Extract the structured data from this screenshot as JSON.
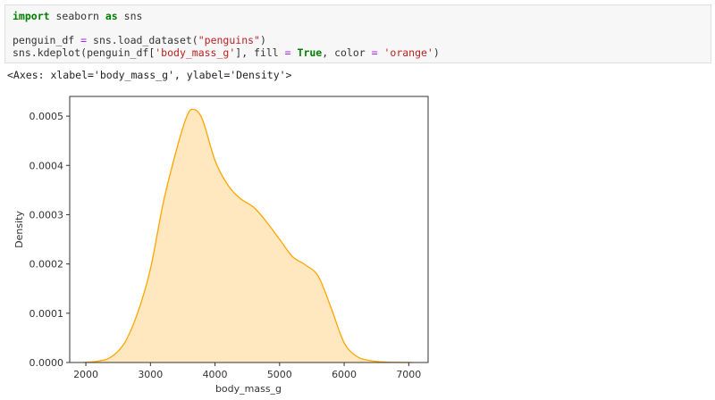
{
  "code": {
    "line1": {
      "kw1": "import",
      "mid": " seaborn ",
      "kw2": "as",
      "end": " sns"
    },
    "line3": {
      "a": "penguin_df ",
      "op": "=",
      "b": " sns.load_dataset(",
      "s": "\"penguins\"",
      "c": ")"
    },
    "line4": {
      "a": "sns.kdeplot(penguin_df[",
      "s1": "'body_mass_g'",
      "b": "], fill ",
      "op1": "=",
      "kw": " True",
      "c": ", color ",
      "op2": "=",
      "s2": " 'orange'",
      "d": ")"
    }
  },
  "output_text": "<Axes: xlabel='body_mass_g', ylabel='Density'>",
  "chart_data": {
    "type": "area",
    "title": "",
    "xlabel": "body_mass_g",
    "ylabel": "Density",
    "xlim": [
      1750,
      7300
    ],
    "ylim": [
      0,
      0.00054
    ],
    "xticks": [
      "2000",
      "3000",
      "4000",
      "5000",
      "6000",
      "7000"
    ],
    "yticks": [
      "0.0000",
      "0.0001",
      "0.0002",
      "0.0003",
      "0.0004",
      "0.0005"
    ],
    "grid": false,
    "color": "#ffa500",
    "fill_opacity": 0.25,
    "x": [
      1950,
      2200,
      2400,
      2600,
      2800,
      3000,
      3200,
      3400,
      3550,
      3650,
      3800,
      4000,
      4200,
      4400,
      4600,
      4800,
      5000,
      5200,
      5400,
      5600,
      5800,
      6000,
      6200,
      6400,
      6600,
      6800,
      7050
    ],
    "y": [
      0,
      3e-06,
      1.2e-05,
      4e-05,
      0.0001,
      0.00019,
      0.000325,
      0.00043,
      0.000495,
      0.000514,
      0.000495,
      0.00041,
      0.00036,
      0.000332,
      0.000315,
      0.000285,
      0.00025,
      0.000215,
      0.000198,
      0.000175,
      0.00011,
      4e-05,
      1.2e-05,
      4e-06,
      1e-06,
      3e-07,
      0
    ]
  }
}
